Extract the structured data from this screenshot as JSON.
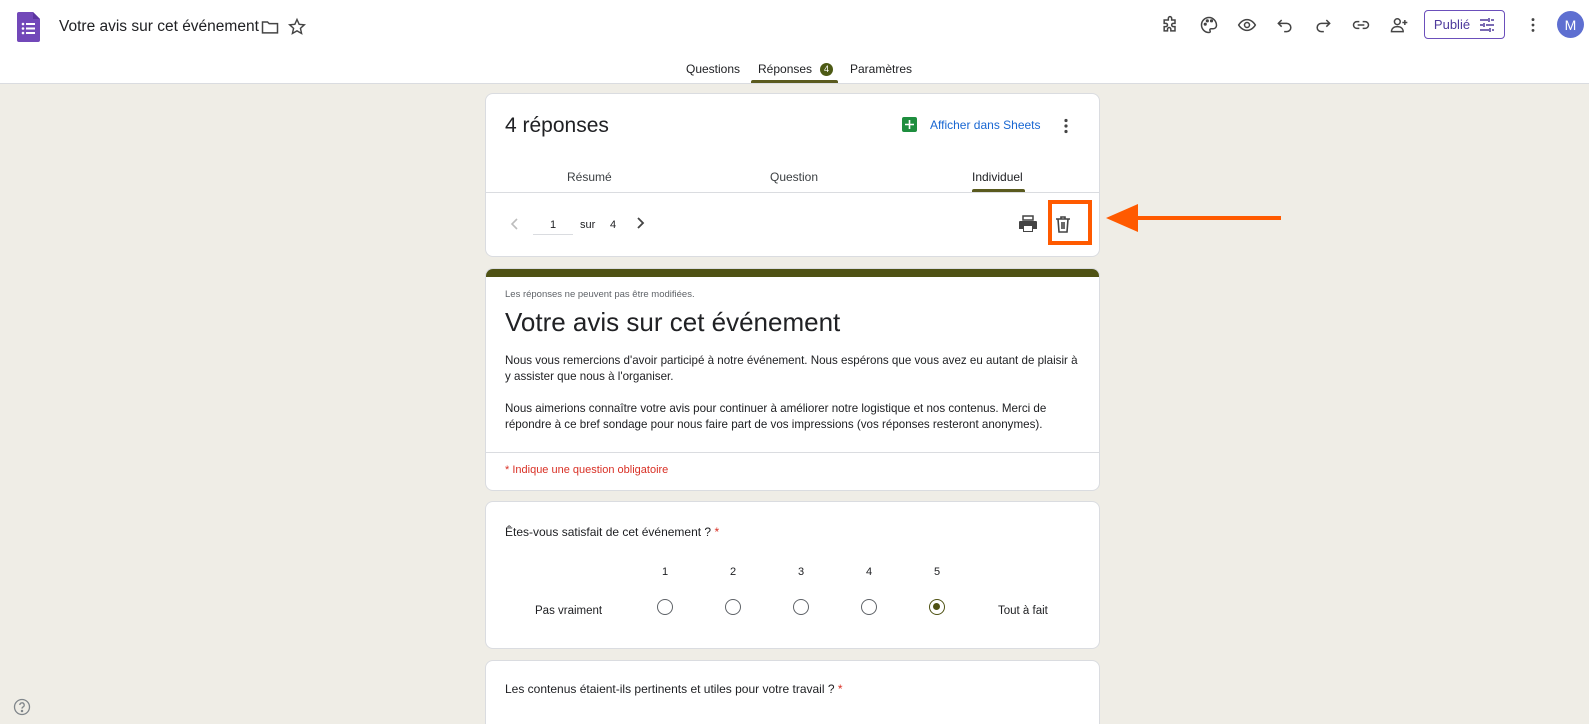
{
  "header": {
    "title": "Votre avis sur cet événement",
    "publish_label": "Publié",
    "avatar_initial": "M",
    "icons": [
      "folder-icon",
      "star-icon",
      "addon-icon",
      "palette-icon",
      "preview-icon",
      "undo-icon",
      "redo-icon",
      "link-icon",
      "add-collaborator-icon",
      "more-vert-icon"
    ]
  },
  "tabs": {
    "questions": "Questions",
    "responses": "Réponses",
    "responses_badge": "4",
    "settings": "Paramètres"
  },
  "summary": {
    "count_label": "4 réponses",
    "sheets_label": "Afficher dans Sheets",
    "subtabs": {
      "summary": "Résumé",
      "question": "Question",
      "individual": "Individuel"
    },
    "pager": {
      "current": "1",
      "sur": "sur",
      "total": "4"
    }
  },
  "form": {
    "readonly_note": "Les réponses ne peuvent pas être modifiées.",
    "title": "Votre avis sur cet événement",
    "desc_p1": "Nous vous remercions d'avoir participé à notre événement. Nous espérons que vous avez eu autant de plaisir à y assister que nous à l'organiser.",
    "desc_p2": "Nous aimerions connaître votre avis pour continuer à améliorer notre logistique et nos contenus. Merci de répondre à ce bref sondage pour nous faire part de vos impressions (vos réponses resteront anonymes).",
    "required_note": "* Indique une question obligatoire"
  },
  "q1": {
    "title": "Êtes-vous satisfait de cet événement ?",
    "star": "*",
    "scale": [
      "1",
      "2",
      "3",
      "4",
      "5"
    ],
    "low_label": "Pas vraiment",
    "high_label": "Tout à fait",
    "selected": "5"
  },
  "q2": {
    "title": "Les contenus étaient-ils pertinents et utiles pour votre travail ?",
    "star": "*"
  },
  "colors": {
    "accent": "#4f5214",
    "highlight": "#ff5a00",
    "link": "#1967d2",
    "required": "#d93025"
  }
}
